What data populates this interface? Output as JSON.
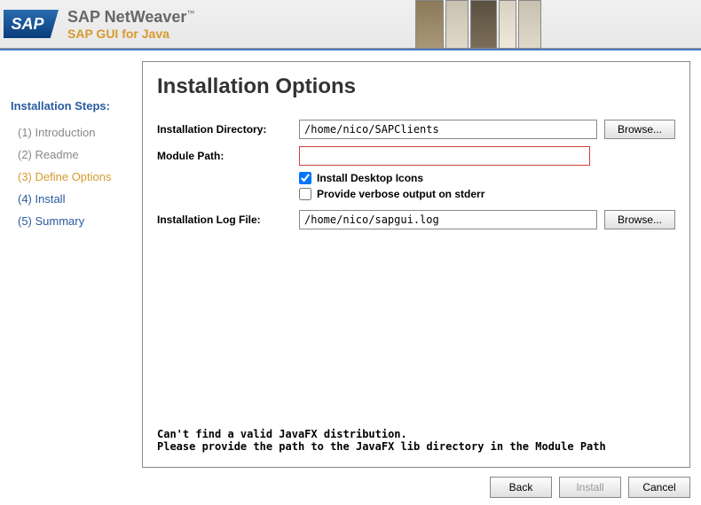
{
  "header": {
    "logo": "SAP",
    "title": "SAP NetWeaver",
    "subtitle": "SAP GUI for Java"
  },
  "sidebar": {
    "title": "Installation Steps:",
    "steps": [
      {
        "label": "(1) Introduction",
        "state": "past"
      },
      {
        "label": "(2) Readme",
        "state": "past"
      },
      {
        "label": "(3) Define Options",
        "state": "active"
      },
      {
        "label": "(4) Install",
        "state": "future"
      },
      {
        "label": "(5) Summary",
        "state": "future"
      }
    ]
  },
  "main": {
    "title": "Installation Options",
    "labels": {
      "install_dir": "Installation Directory:",
      "module_path": "Module Path:",
      "log_file": "Installation Log File:"
    },
    "values": {
      "install_dir": "/home/nico/SAPClients",
      "module_path": "",
      "log_file": "/home/nico/sapgui.log"
    },
    "browse": "Browse...",
    "checks": {
      "desktop_icons": {
        "label": "Install Desktop Icons",
        "checked": true
      },
      "verbose": {
        "label": "Provide verbose output on stderr",
        "checked": false
      }
    },
    "error": "Can't find a valid JavaFX distribution.\nPlease provide the path to the JavaFX lib directory in the Module Path"
  },
  "footer": {
    "back": "Back",
    "install": "Install",
    "cancel": "Cancel"
  }
}
